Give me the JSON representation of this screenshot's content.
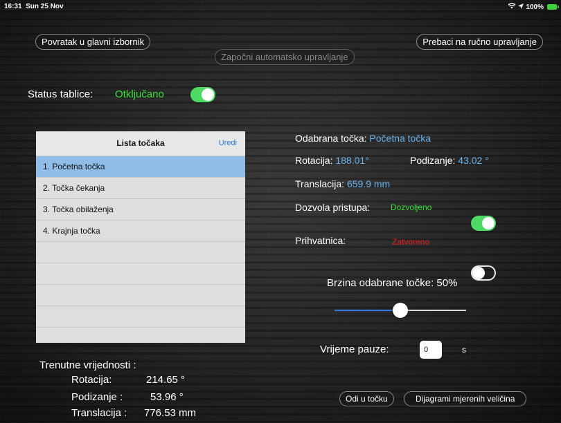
{
  "status_bar": {
    "time": "16:31",
    "date": "Sun 25 Nov",
    "battery": "100%"
  },
  "nav": {
    "back": "Povratak u glavni izbornik",
    "manual": "Prebaci na ručno upravljanje",
    "auto": "Započni automatsko upravljanje"
  },
  "plate_status": {
    "label": "Status tablice:",
    "value": "Otključano",
    "toggle_on": true
  },
  "points_list": {
    "title": "Lista točaka",
    "edit": "Uredi",
    "items": [
      "1. Početna točka",
      "2. Točka čekanja",
      "3. Točka obilaženja",
      "4. Krajnja točka"
    ],
    "selected_index": 0
  },
  "selected_point": {
    "label": "Odabrana točka:",
    "value": "Početna točka",
    "rotation_label": "Rotacija:",
    "rotation_value": "188.01°",
    "lift_label": "Podizanje:",
    "lift_value": "43.02 °",
    "translation_label": "Translacija:",
    "translation_value": "659.9 mm"
  },
  "access": {
    "label": "Dozvola pristupa:",
    "value": "Dozvoljeno",
    "toggle_on": true
  },
  "gripper": {
    "label": "Prihvatnica:",
    "value": "Zatvoreno",
    "toggle_on": false
  },
  "speed": {
    "label": "Brzina odabrane točke: 50%",
    "percent": 50
  },
  "pause": {
    "label": "Vrijeme pauze:",
    "value": "0",
    "unit": "s"
  },
  "current": {
    "title": "Trenutne vrijednosti :",
    "rotation_label": "Rotacija:",
    "rotation_value": "214.65 °",
    "lift_label": "Podizanje :",
    "lift_value": "53.96 °",
    "translation_label": "Translacija :",
    "translation_value": "776.53 mm"
  },
  "actions": {
    "go_to_point": "Odi u točku",
    "diagrams": "Dijagrami mjerenih veličina"
  }
}
